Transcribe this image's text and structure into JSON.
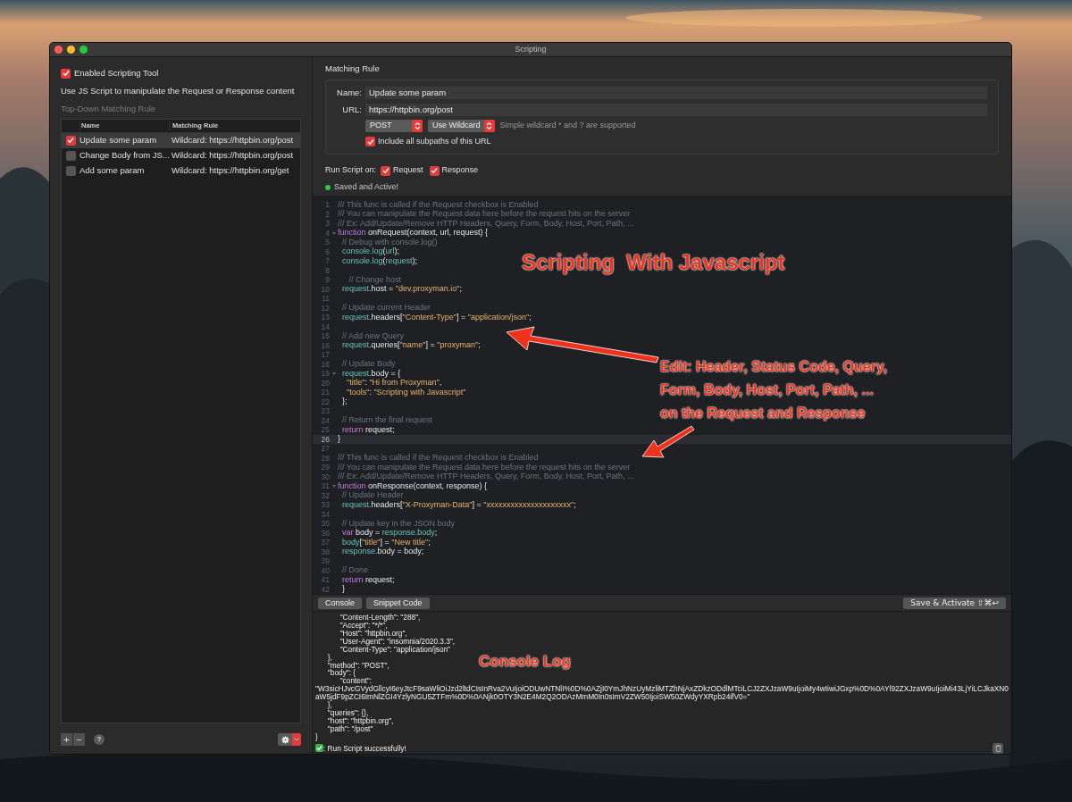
{
  "window": {
    "title": "Scripting"
  },
  "sidebar": {
    "enable": {
      "label": "Enabled Scripting Tool",
      "checked": true
    },
    "description": "Use JS Script to manipulate the Request or Response content",
    "section_label": "Top-Down Matching Rule",
    "table": {
      "columns": [
        "Name",
        "Matching Rule"
      ],
      "rows": [
        {
          "name": "Update some param",
          "rule": "Wildcard: https://httpbin.org/post",
          "checked": true,
          "selected": true
        },
        {
          "name": "Change Body from JS...",
          "rule": "Wildcard: https://httpbin.org/post",
          "checked": false,
          "selected": false
        },
        {
          "name": "Add some param",
          "rule": "Wildcard: https://httpbin.org/get",
          "checked": false,
          "selected": false
        }
      ]
    },
    "footer": {
      "add": "+",
      "remove": "−",
      "help": "?"
    }
  },
  "matching_rule": {
    "title": "Matching Rule",
    "name_label": "Name:",
    "name_value": "Update some param",
    "url_label": "URL:",
    "url_value": "https://httpbin.org/post",
    "method": "POST",
    "match_type": "Use Wildcard",
    "hint": "Simple wildcard * and ? are supported",
    "subpaths": {
      "label": "Include all subpaths of this URL",
      "checked": true
    }
  },
  "run_script": {
    "label": "Run Script on:",
    "options": [
      {
        "label": "Request",
        "checked": true
      },
      {
        "label": "Response",
        "checked": true
      }
    ],
    "status": {
      "text": "Saved and Active!",
      "active": true
    }
  },
  "editor": {
    "lines": [
      {
        "number": "1",
        "tokens": [
          {
            "kind": "comment",
            "text": "/// This func is called if the Request checkbox is Enabled"
          }
        ]
      },
      {
        "number": "2",
        "tokens": [
          {
            "kind": "comment",
            "text": "/// You can manipulate the Request data here before the request hits on the server"
          }
        ]
      },
      {
        "number": "3",
        "tokens": [
          {
            "kind": "comment",
            "text": "/// Ex: Add/Update/Remove HTTP Headers, Query, Form, Body, Host, Port, Path, ..."
          }
        ]
      },
      {
        "number": "4",
        "foldable": true,
        "tokens": [
          {
            "kind": "keyword",
            "text": "function"
          },
          {
            "kind": "plain",
            "text": " onRequest(context, url, request) {"
          }
        ]
      },
      {
        "number": "5",
        "tokens": [
          {
            "kind": "comment",
            "text": "  // Debug with console.log()"
          }
        ]
      },
      {
        "number": "6",
        "tokens": [
          {
            "kind": "ident",
            "text": "  console.log"
          },
          {
            "kind": "plain",
            "text": "("
          },
          {
            "kind": "ident",
            "text": "url"
          },
          {
            "kind": "plain",
            "text": ");"
          }
        ]
      },
      {
        "number": "7",
        "tokens": [
          {
            "kind": "ident",
            "text": "  console.log"
          },
          {
            "kind": "plain",
            "text": "("
          },
          {
            "kind": "ident",
            "text": "request"
          },
          {
            "kind": "plain",
            "text": ");"
          }
        ]
      },
      {
        "number": "8"
      },
      {
        "number": "9",
        "tokens": [
          {
            "kind": "comment",
            "text": "     // Change host"
          }
        ]
      },
      {
        "number": "10",
        "tokens": [
          {
            "kind": "ident",
            "text": "  request"
          },
          {
            "kind": "plain",
            "text": ".host = "
          },
          {
            "kind": "string",
            "text": "\"dev.proxyman.io\""
          },
          {
            "kind": "plain",
            "text": ";"
          }
        ]
      },
      {
        "number": "11"
      },
      {
        "number": "12",
        "tokens": [
          {
            "kind": "comment",
            "text": "  // Update current Header"
          }
        ]
      },
      {
        "number": "13",
        "tokens": [
          {
            "kind": "ident",
            "text": "  request"
          },
          {
            "kind": "plain",
            "text": ".headers["
          },
          {
            "kind": "string",
            "text": "\"Content-Type\""
          },
          {
            "kind": "plain",
            "text": "] = "
          },
          {
            "kind": "string",
            "text": "\"application/json\""
          },
          {
            "kind": "plain",
            "text": ";"
          }
        ]
      },
      {
        "number": "14"
      },
      {
        "number": "15",
        "tokens": [
          {
            "kind": "comment",
            "text": "  // Add new Query"
          }
        ]
      },
      {
        "number": "16",
        "tokens": [
          {
            "kind": "ident",
            "text": "  request"
          },
          {
            "kind": "plain",
            "text": ".queries["
          },
          {
            "kind": "string",
            "text": "\"name\""
          },
          {
            "kind": "plain",
            "text": "] = "
          },
          {
            "kind": "string",
            "text": "\"proxyman\""
          },
          {
            "kind": "plain",
            "text": ";"
          }
        ]
      },
      {
        "number": "17"
      },
      {
        "number": "18",
        "tokens": [
          {
            "kind": "comment",
            "text": "  // Update Body"
          }
        ]
      },
      {
        "number": "19",
        "foldable": true,
        "tokens": [
          {
            "kind": "ident",
            "text": "  request"
          },
          {
            "kind": "plain",
            "text": ".body = {"
          }
        ]
      },
      {
        "number": "20",
        "tokens": [
          {
            "kind": "string",
            "text": "    \"title\""
          },
          {
            "kind": "plain",
            "text": ": "
          },
          {
            "kind": "string",
            "text": "\"Hi from Proxyman\""
          },
          {
            "kind": "plain",
            "text": ","
          }
        ]
      },
      {
        "number": "21",
        "tokens": [
          {
            "kind": "string",
            "text": "    \"tools\""
          },
          {
            "kind": "plain",
            "text": ": "
          },
          {
            "kind": "string",
            "text": "\"Scripting with Javascript\""
          }
        ]
      },
      {
        "number": "22",
        "tokens": [
          {
            "kind": "plain",
            "text": "  };"
          }
        ]
      },
      {
        "number": "23"
      },
      {
        "number": "24",
        "tokens": [
          {
            "kind": "comment",
            "text": "  // Return the final request"
          }
        ]
      },
      {
        "number": "25",
        "tokens": [
          {
            "kind": "keyword",
            "text": "  return"
          },
          {
            "kind": "plain",
            "text": " request;"
          }
        ]
      },
      {
        "number": "26",
        "current": true,
        "tokens": [
          {
            "kind": "plain",
            "text": "}"
          }
        ]
      },
      {
        "number": "27"
      },
      {
        "number": "28",
        "tokens": [
          {
            "kind": "comment",
            "text": "/// This func is called if the Request checkbox is Enabled"
          }
        ]
      },
      {
        "number": "29",
        "tokens": [
          {
            "kind": "comment",
            "text": "/// You can manipulate the Request data here before the request hits on the server"
          }
        ]
      },
      {
        "number": "30",
        "tokens": [
          {
            "kind": "comment",
            "text": "/// Ex: Add/Update/Remove HTTP Headers, Query, Form, Body, Host, Port, Path, ..."
          }
        ]
      },
      {
        "number": "31",
        "foldable": true,
        "tokens": [
          {
            "kind": "keyword",
            "text": "function"
          },
          {
            "kind": "plain",
            "text": " onResponse(context, response) {"
          }
        ]
      },
      {
        "number": "32",
        "tokens": [
          {
            "kind": "comment",
            "text": "  // Update Header"
          }
        ]
      },
      {
        "number": "33",
        "tokens": [
          {
            "kind": "ident",
            "text": "  request"
          },
          {
            "kind": "plain",
            "text": ".headers["
          },
          {
            "kind": "string",
            "text": "\"X-Proxyman-Data\""
          },
          {
            "kind": "plain",
            "text": "] = "
          },
          {
            "kind": "string",
            "text": "\"xxxxxxxxxxxxxxxxxxxxx\""
          },
          {
            "kind": "plain",
            "text": ";"
          }
        ]
      },
      {
        "number": "34"
      },
      {
        "number": "35",
        "tokens": [
          {
            "kind": "comment",
            "text": "  // Update key in the JSON body"
          }
        ]
      },
      {
        "number": "36",
        "tokens": [
          {
            "kind": "keyword",
            "text": "  var"
          },
          {
            "kind": "plain",
            "text": " body = "
          },
          {
            "kind": "ident",
            "text": "response.body"
          },
          {
            "kind": "plain",
            "text": ";"
          }
        ]
      },
      {
        "number": "37",
        "tokens": [
          {
            "kind": "ident",
            "text": "  body"
          },
          {
            "kind": "plain",
            "text": "["
          },
          {
            "kind": "string",
            "text": "\"title\""
          },
          {
            "kind": "plain",
            "text": "] = "
          },
          {
            "kind": "string",
            "text": "\"New title\""
          },
          {
            "kind": "plain",
            "text": ";"
          }
        ]
      },
      {
        "number": "38",
        "tokens": [
          {
            "kind": "ident",
            "text": "  response"
          },
          {
            "kind": "plain",
            "text": ".body = body;"
          }
        ]
      },
      {
        "number": "39"
      },
      {
        "number": "40",
        "tokens": [
          {
            "kind": "comment",
            "text": "  // Done"
          }
        ]
      },
      {
        "number": "41",
        "tokens": [
          {
            "kind": "keyword",
            "text": "  return"
          },
          {
            "kind": "plain",
            "text": " request;"
          }
        ]
      },
      {
        "number": "42",
        "tokens": [
          {
            "kind": "plain",
            "text": "  }"
          }
        ]
      }
    ]
  },
  "toolbar": {
    "buttons": [
      "Console",
      "Snippet Code"
    ],
    "save": "Save & Activate ⇧⌘↩"
  },
  "console": {
    "lines": [
      "            \"Content-Length\": \"288\",",
      "            \"Accept\": \"*/*\",",
      "            \"Host\": \"httpbin.org\",",
      "            \"User-Agent\": \"insomnia/2020.3.3\",",
      "            \"Content-Type\": \"application/json\"",
      "      },",
      "      \"method\": \"POST\",",
      "      \"body\": {",
      "            \"content\":",
      "\"W3sicHJvcGVydGllcyI6eyJtcF9saWliOiJzd2ltdCIsInRva2VuIjoiODUwNTNlI%0D%0AZjI0YmJhNzUyMzliMTZhNjAxZDkzODdlMTciLCJ2ZXJzaW9uIjoiMy4wIiwiJGxp%0D%0AYl92ZXJzaW9uIjoiMi43LjYiLCJkaXN0aW5jdF9pZCI6ImNlZGI4YzlyNGU5ZTFm%0D%0ANjk0OTY3N2E4M2Q2ODAzMmM0In0sImV2ZW50IjoiSW50ZWdyYXRpb24ifV0=\"",
      "      },",
      "      \"queries\": {},",
      "      \"host\": \"httpbin.org\",",
      "      \"path\": \"/post\"",
      "}"
    ],
    "status": ": Run Script successfully!"
  },
  "annotations": [
    "Scripting  With Javascript",
    "Edit: Header, Status Code, Query,\nForm, Body, Host, Port, Path, ...\non the Request and Response",
    "Console Log"
  ]
}
